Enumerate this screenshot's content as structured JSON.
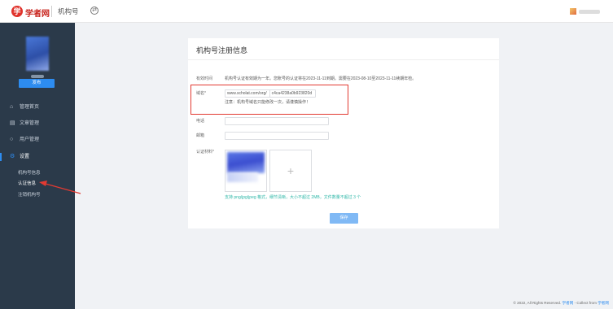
{
  "header": {
    "logo_char": "学",
    "brand": "学者网",
    "section_title": "机构号",
    "switch_icon": "swap-icon"
  },
  "sidebar": {
    "publish_label": "发布",
    "nav": [
      {
        "label": "管理首页",
        "icon": "home-icon"
      },
      {
        "label": "文章管理",
        "icon": "document-icon"
      },
      {
        "label": "用户管理",
        "icon": "chat-icon"
      },
      {
        "label": "设置",
        "icon": "gear-icon"
      }
    ],
    "settings_sub": [
      "机构号信息",
      "认证信息",
      "注销机构号"
    ],
    "active_color": "#2d8cf0"
  },
  "form": {
    "title": "机构号注册信息",
    "validity_label": "有效时间",
    "validity_text": "机构号认证有效期为一年。您账号的认证将在2023-11-11到期。需要在2023-08-10至2023-11-11续期年检。",
    "domain_label": "域名*",
    "domain_prefix": "www.scholat.com/org/",
    "domain_value": "c4ca4238a0b923820d",
    "domain_tip": "注意：机构号域名只能修改一次，请谨慎操作！",
    "phone_label": "电话",
    "phone_value": "",
    "email_label": "邮箱",
    "email_value": "",
    "cert_label": "认证材料*",
    "upload_plus": "+",
    "upload_hint": "支持 png/jpg/jpeg 格式，细节清晰，大小不超过 2MB，文件数量不超过 3 个",
    "submit_label": "保存"
  },
  "footer": {
    "copyright": "© 2022, All Rights Reserved. ",
    "site": "学者网",
    "collect_text": " - Collect from ",
    "collect_site": "学者网"
  },
  "colors": {
    "sidebar_bg": "#2b3a4a",
    "accent": "#2d8cf0",
    "highlight_red": "#e23a32"
  }
}
